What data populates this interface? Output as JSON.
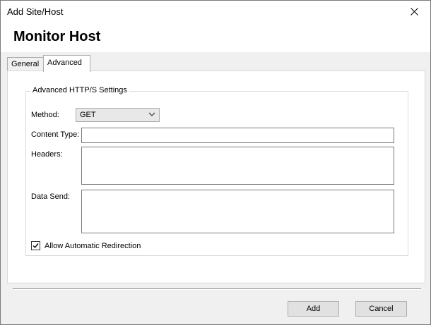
{
  "window": {
    "title": "Add Site/Host"
  },
  "header": {
    "title": "Monitor Host"
  },
  "tabs": [
    {
      "label": "General",
      "selected": false
    },
    {
      "label": "Advanced",
      "selected": true
    }
  ],
  "advanced": {
    "group_title": "Advanced HTTP/S Settings",
    "method_label": "Method:",
    "method_value": "GET",
    "content_type_label": "Content Type:",
    "content_type_value": "",
    "headers_label": "Headers:",
    "headers_value": "",
    "data_send_label": "Data Send:",
    "data_send_value": "",
    "allow_redirection_label": "Allow Automatic Redirection",
    "allow_redirection_checked": true
  },
  "footer": {
    "add_label": "Add",
    "cancel_label": "Cancel"
  },
  "icons": {
    "close": "close-icon",
    "dropdown": "chevron-down-icon",
    "check": "check-icon"
  }
}
